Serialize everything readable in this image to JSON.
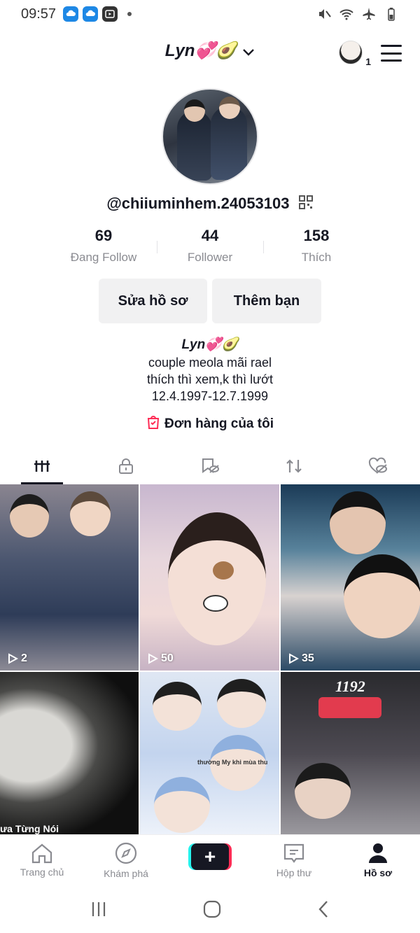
{
  "status": {
    "time": "09:57"
  },
  "header": {
    "username": "Lyn💞🥑",
    "friend_count": "1",
    "handle": "@chiiuminhem.24053103"
  },
  "stats": [
    {
      "value": "69",
      "label": "Đang Follow"
    },
    {
      "value": "44",
      "label": "Follower"
    },
    {
      "value": "158",
      "label": "Thích"
    }
  ],
  "buttons": {
    "edit_profile": "Sửa hồ sơ",
    "add_friends": "Thêm bạn"
  },
  "bio": {
    "name": "Lyn💞🥑",
    "lines": [
      "couple meola mãi rael",
      "thích thì xem,k thì lướt",
      "12.4.1997-12.7.1999"
    ],
    "orders": "Đơn hàng của tôi"
  },
  "tabs": [
    "videos-grid",
    "private",
    "favorites",
    "reposts",
    "liked"
  ],
  "videos": [
    {
      "views": "2"
    },
    {
      "views": "50"
    },
    {
      "views": "35"
    },
    {
      "overlay": "ưa Từng Nói"
    },
    {
      "overlay": "thường My khi mùa thu"
    },
    {
      "overlay": "1192"
    }
  ],
  "nav": {
    "home": "Trang chủ",
    "discover": "Khám phá",
    "inbox": "Hộp thư",
    "profile": "Hồ sơ"
  },
  "colors": {
    "text": "#161823",
    "muted": "#8a8b91",
    "accent_red": "#fe2c55",
    "accent_cyan": "#25f4ee",
    "button_bg": "#f1f1f2"
  }
}
